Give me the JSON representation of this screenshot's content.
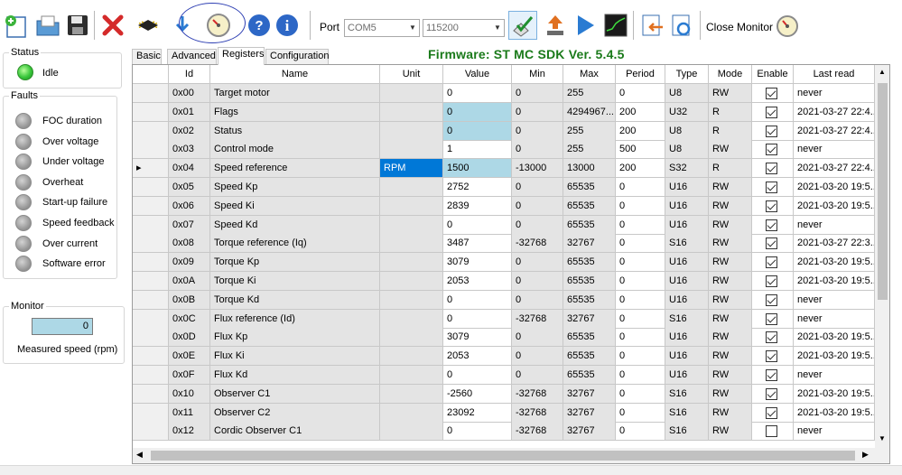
{
  "toolbar": {
    "port_label": "Port",
    "port_value": "COM5",
    "baud_value": "115200",
    "close_monitor_label": "Close Monitor",
    "icons": [
      "new-file-icon",
      "open-folder-icon",
      "save-floppy-icon",
      "close-red-x-icon",
      "chip-icon",
      "download-arrow-icon",
      "gauge-monitor-icon",
      "help-icon",
      "info-icon",
      "check-connect-icon",
      "upload-icon",
      "play-icon",
      "scope-icon",
      "export-icon",
      "refresh-doc-icon",
      "gauge-icon"
    ]
  },
  "firmware": "Firmware: ST MC SDK Ver. 5.4.5",
  "status": {
    "legend": "Status",
    "state": "Idle"
  },
  "faults": {
    "legend": "Faults",
    "items": [
      "FOC duration",
      "Over voltage",
      "Under voltage",
      "Overheat",
      "Start-up failure",
      "Speed feedback",
      "Over current",
      "Software error"
    ]
  },
  "monitor": {
    "legend": "Monitor",
    "value": "0",
    "caption": "Measured speed (rpm)"
  },
  "tabs": [
    "Basic",
    "Advanced",
    "Registers",
    "Configuration"
  ],
  "active_tab": "Registers",
  "table": {
    "headers": [
      "Id",
      "Name",
      "Unit",
      "Value",
      "Min",
      "Max",
      "Period",
      "Type",
      "Mode",
      "Enable",
      "Last read"
    ],
    "rows": [
      {
        "id": "0x00",
        "name": "Target motor",
        "unit": "",
        "value": "0",
        "min": "0",
        "max": "255",
        "period": "0",
        "type": "U8",
        "mode": "RW",
        "enable": true,
        "last": "never"
      },
      {
        "id": "0x01",
        "name": "Flags",
        "unit": "",
        "value": "0",
        "min": "0",
        "max": "4294967...",
        "period": "200",
        "type": "U32",
        "mode": "R",
        "enable": true,
        "last": "2021-03-27 22:4..."
      },
      {
        "id": "0x02",
        "name": "Status",
        "unit": "",
        "value": "0",
        "min": "0",
        "max": "255",
        "period": "200",
        "type": "U8",
        "mode": "R",
        "enable": true,
        "last": "2021-03-27 22:4..."
      },
      {
        "id": "0x03",
        "name": "Control mode",
        "unit": "",
        "value": "1",
        "min": "0",
        "max": "255",
        "period": "500",
        "type": "U8",
        "mode": "RW",
        "enable": true,
        "last": "never"
      },
      {
        "id": "0x04",
        "name": "Speed reference",
        "unit": "RPM",
        "value": "1500",
        "min": "-13000",
        "max": "13000",
        "period": "200",
        "type": "S32",
        "mode": "R",
        "enable": true,
        "last": "2021-03-27 22:4..."
      },
      {
        "id": "0x05",
        "name": "Speed Kp",
        "unit": "",
        "value": "2752",
        "min": "0",
        "max": "65535",
        "period": "0",
        "type": "U16",
        "mode": "RW",
        "enable": true,
        "last": "2021-03-20 19:5..."
      },
      {
        "id": "0x06",
        "name": "Speed Ki",
        "unit": "",
        "value": "2839",
        "min": "0",
        "max": "65535",
        "period": "0",
        "type": "U16",
        "mode": "RW",
        "enable": true,
        "last": "2021-03-20 19:5..."
      },
      {
        "id": "0x07",
        "name": "Speed Kd",
        "unit": "",
        "value": "0",
        "min": "0",
        "max": "65535",
        "period": "0",
        "type": "U16",
        "mode": "RW",
        "enable": true,
        "last": "never"
      },
      {
        "id": "0x08",
        "name": "Torque reference (Iq)",
        "unit": "",
        "value": "3487",
        "min": "-32768",
        "max": "32767",
        "period": "0",
        "type": "S16",
        "mode": "RW",
        "enable": true,
        "last": "2021-03-27 22:3..."
      },
      {
        "id": "0x09",
        "name": "Torque Kp",
        "unit": "",
        "value": "3079",
        "min": "0",
        "max": "65535",
        "period": "0",
        "type": "U16",
        "mode": "RW",
        "enable": true,
        "last": "2021-03-20 19:5..."
      },
      {
        "id": "0x0A",
        "name": "Torque Ki",
        "unit": "",
        "value": "2053",
        "min": "0",
        "max": "65535",
        "period": "0",
        "type": "U16",
        "mode": "RW",
        "enable": true,
        "last": "2021-03-20 19:5..."
      },
      {
        "id": "0x0B",
        "name": "Torque Kd",
        "unit": "",
        "value": "0",
        "min": "0",
        "max": "65535",
        "period": "0",
        "type": "U16",
        "mode": "RW",
        "enable": true,
        "last": "never"
      },
      {
        "id": "0x0C",
        "name": "Flux reference (Id)",
        "unit": "",
        "value": "0",
        "min": "-32768",
        "max": "32767",
        "period": "0",
        "type": "S16",
        "mode": "RW",
        "enable": true,
        "last": "never"
      },
      {
        "id": "0x0D",
        "name": "Flux Kp",
        "unit": "",
        "value": "3079",
        "min": "0",
        "max": "65535",
        "period": "0",
        "type": "U16",
        "mode": "RW",
        "enable": true,
        "last": "2021-03-20 19:5..."
      },
      {
        "id": "0x0E",
        "name": "Flux Ki",
        "unit": "",
        "value": "2053",
        "min": "0",
        "max": "65535",
        "period": "0",
        "type": "U16",
        "mode": "RW",
        "enable": true,
        "last": "2021-03-20 19:5..."
      },
      {
        "id": "0x0F",
        "name": "Flux Kd",
        "unit": "",
        "value": "0",
        "min": "0",
        "max": "65535",
        "period": "0",
        "type": "U16",
        "mode": "RW",
        "enable": true,
        "last": "never"
      },
      {
        "id": "0x10",
        "name": "Observer C1",
        "unit": "",
        "value": "-2560",
        "min": "-32768",
        "max": "32767",
        "period": "0",
        "type": "S16",
        "mode": "RW",
        "enable": true,
        "last": "2021-03-20 19:5..."
      },
      {
        "id": "0x11",
        "name": "Observer C2",
        "unit": "",
        "value": "23092",
        "min": "-32768",
        "max": "32767",
        "period": "0",
        "type": "S16",
        "mode": "RW",
        "enable": true,
        "last": "2021-03-20 19:5..."
      },
      {
        "id": "0x12",
        "name": "Cordic Observer C1",
        "unit": "",
        "value": "0",
        "min": "-32768",
        "max": "32767",
        "period": "0",
        "type": "S16",
        "mode": "RW",
        "enable": false,
        "last": "never"
      }
    ]
  }
}
